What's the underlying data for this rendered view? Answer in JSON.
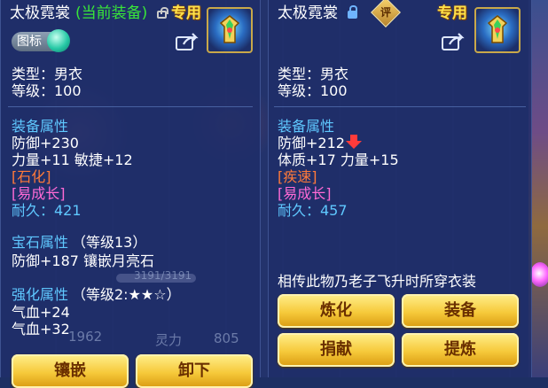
{
  "left": {
    "name": "太极霓裳",
    "status": "(当前装备)",
    "badge": "专用",
    "icon_toggle_label": "图标",
    "type_line": "类型：男衣",
    "level_line": "等级：100",
    "attr_header": "装备属性",
    "attr_lines": [
      "防御+230",
      "力量+11 敏捷+12"
    ],
    "special_1": "[石化]",
    "special_2": "[易成长]",
    "durability_line": "耐久：421",
    "gem_header": "宝石属性",
    "gem_level": "（等级13）",
    "gem_line": "防御+187 镶嵌月亮石",
    "enhance_header": "强化属性",
    "enhance_level": "（等级2:★★☆）",
    "enhance_lines": [
      "气血+24",
      "气血+32"
    ],
    "bg_texts": [
      "3191/3191",
      "1962",
      "灵力",
      "805"
    ],
    "buttons": [
      "镶嵌",
      "卸下"
    ]
  },
  "right": {
    "name": "太极霓裳",
    "appraise_label": "评",
    "badge": "专用",
    "type_line": "类型：男衣",
    "level_line": "等级：100",
    "attr_header": "装备属性",
    "attr_lines": [
      "防御+212",
      "体质+17 力量+15"
    ],
    "special_1": "[疾速]",
    "special_2": "[易成长]",
    "durability_line": "耐久：457",
    "description": "相传此物乃老子飞升时所穿衣装",
    "buttons": [
      "炼化",
      "装备",
      "捐献",
      "提炼"
    ]
  },
  "colors": {
    "green": "#39e639",
    "blue": "#5fc8ff",
    "pink": "#ff6ad5",
    "orange": "#ff7a3a",
    "gold_button": "#f6c93a"
  },
  "icons": [
    "unlock-icon",
    "lock-icon",
    "share-icon",
    "item-robe-icon",
    "appraise-diamond-icon",
    "down-arrow-icon"
  ]
}
